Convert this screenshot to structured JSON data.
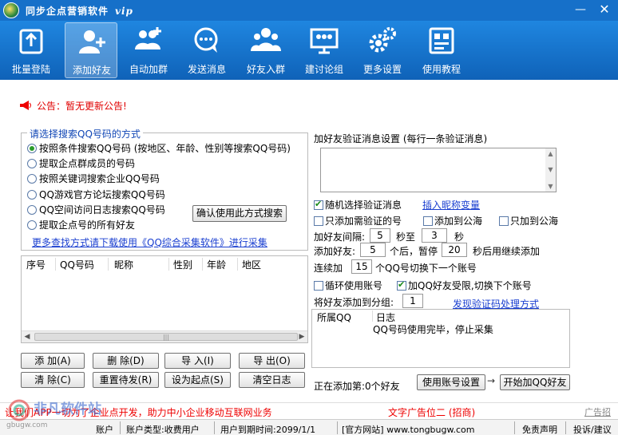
{
  "window": {
    "title": "同步企点营销软件",
    "edition": "vip"
  },
  "toolbar": [
    {
      "label": "批量登陆",
      "icon": "upload-icon"
    },
    {
      "label": "添加好友",
      "icon": "add-user-icon",
      "active": true
    },
    {
      "label": "自动加群",
      "icon": "add-group-icon"
    },
    {
      "label": "发送消息",
      "icon": "chat-icon"
    },
    {
      "label": "好友入群",
      "icon": "users-icon"
    },
    {
      "label": "建讨论组",
      "icon": "presentation-icon"
    },
    {
      "label": "更多设置",
      "icon": "gear-icon"
    },
    {
      "label": "使用教程",
      "icon": "tutorial-icon"
    }
  ],
  "notice": "公告：暂无更新公告!",
  "search_method": {
    "title": "请选择搜索QQ号码的方式",
    "options": [
      "按照条件搜索QQ号码 (按地区、年龄、性别等搜索QQ号码)",
      "提取企点群成员的号码",
      "按照关键词搜索企业QQ号码",
      "QQ游戏官方论坛搜索QQ号码",
      "QQ空间访问日志搜索QQ号码",
      "提取企点号的所有好友"
    ],
    "selected": 0,
    "confirm_button": "确认使用此方式搜索",
    "more_link": "更多查找方式请下载使用《QQ综合采集软件》进行采集"
  },
  "result_table": {
    "columns": [
      "序号",
      "QQ号码",
      "昵称",
      "性别",
      "年龄",
      "地区"
    ]
  },
  "buttons": {
    "add": "添 加(A)",
    "delete": "删 除(D)",
    "import": "导 入(I)",
    "export": "导 出(O)",
    "clear": "清 除(C)",
    "reset": "重置待发(R)",
    "set_start": "设为起点(S)",
    "clear_log": "清空日志"
  },
  "verify": {
    "label": "加好友验证消息设置 (每行一条验证消息)",
    "random_label": "随机选择验证消息",
    "random_checked": true,
    "insert_nick_link": "插入昵称变量",
    "only_verify_label": "只添加需验证的号",
    "add_to_sea_label": "添加到公海",
    "only_sea_label": "只加到公海"
  },
  "interval": {
    "label": "加好友间隔:",
    "from": "5",
    "to_label": "秒至",
    "to": "3",
    "unit": "秒"
  },
  "pause": {
    "label": "添加好友:",
    "count": "5",
    "after_label": "个后，暂停",
    "seconds": "20",
    "resume_label": "秒后用继续添加"
  },
  "switch": {
    "label": "连续加",
    "count": "15",
    "suffix": "个QQ号切换下一个账号"
  },
  "loop": {
    "loop_label": "循环使用账号",
    "limit_label": "加QQ好友受限,切换下个账号",
    "limit_checked": true
  },
  "group_add": {
    "label": "将好友添加到分组:",
    "value": "1",
    "captcha_link": "发现验证码处理方式"
  },
  "log_table": {
    "columns": [
      "所属QQ",
      "日志"
    ],
    "rows": [
      {
        "qq": "",
        "log": "QQ号码使用完毕，停止采集"
      }
    ]
  },
  "progress_text": "正在添加第:0个好友",
  "account_settings_button": "使用账号设置",
  "start_button": "开始加QQ好友",
  "ads": {
    "left": "让我们APP一切为了企业点开发，助力中小企业移动互联网业务",
    "middle": "文字广告位二 (招商)",
    "right": "广告招租"
  },
  "statusbar": {
    "account": "账户",
    "account_type": "账户类型:收费用户",
    "expire": "用户到期时间:2099/1/1",
    "site": "[官方网站] www.tongbugw.com",
    "disclaimer": "免责声明",
    "feedback": "投诉/建议"
  },
  "watermark": {
    "text": "非凡软件站",
    "sub": "gbugw.com"
  },
  "colors": {
    "titlebar": "#1670c9",
    "toolbar": "#1f86e0",
    "notice": "#e00000",
    "link": "#1a3fd0"
  }
}
